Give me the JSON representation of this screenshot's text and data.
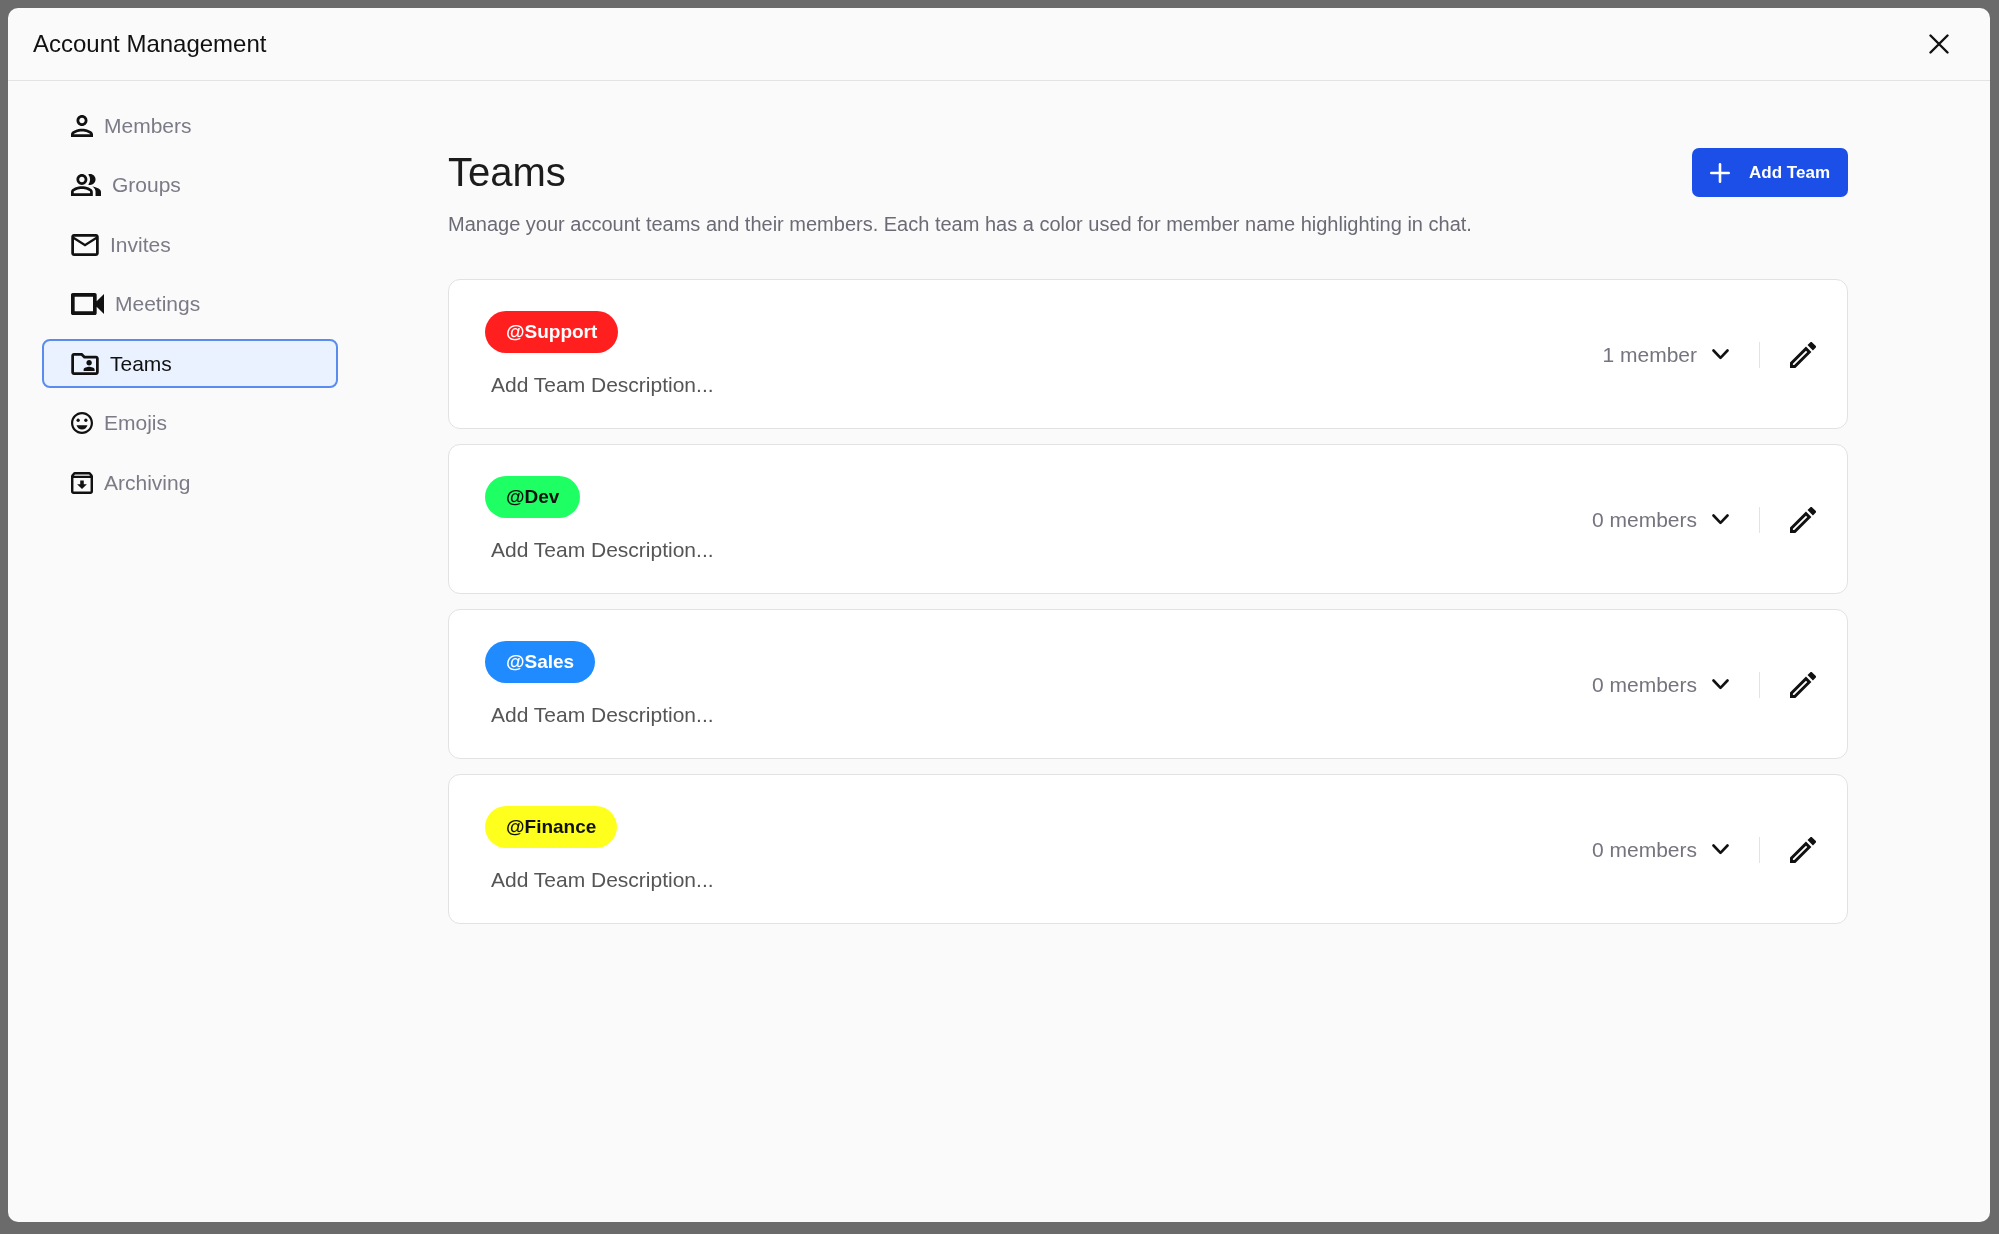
{
  "dialog": {
    "title": "Account Management"
  },
  "sidebar": {
    "items": [
      {
        "label": "Members",
        "selected": false
      },
      {
        "label": "Groups",
        "selected": false
      },
      {
        "label": "Invites",
        "selected": false
      },
      {
        "label": "Meetings",
        "selected": false
      },
      {
        "label": "Teams",
        "selected": true
      },
      {
        "label": "Emojis",
        "selected": false
      },
      {
        "label": "Archiving",
        "selected": false
      }
    ]
  },
  "page": {
    "title": "Teams",
    "description": "Manage your account teams and their members. Each team has a color used for member name highlighting in chat.",
    "add_button": "Add Team"
  },
  "teams": [
    {
      "name": "@Support",
      "color": "#ff1f1f",
      "description": "Add Team Description...",
      "member_count": "1 member"
    },
    {
      "name": "@Dev",
      "color": "#1eff64",
      "description": "Add Team Description...",
      "member_count": "0 members"
    },
    {
      "name": "@Sales",
      "color": "#1f8bff",
      "description": "Add Team Description...",
      "member_count": "0 members"
    },
    {
      "name": "@Finance",
      "color": "#ffff1e",
      "description": "Add Team Description...",
      "member_count": "0 members"
    }
  ]
}
